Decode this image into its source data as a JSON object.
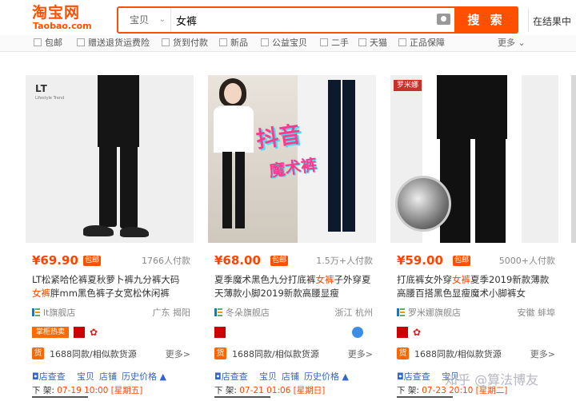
{
  "header": {
    "logo_cn": "淘宝网",
    "logo_en": "Taobao.com",
    "search_scope": "宝贝",
    "search_value": "女裤",
    "search_button": "搜 索",
    "within_results": "在结果中"
  },
  "filters": [
    {
      "label": "包邮"
    },
    {
      "label": "赠送退货运费险"
    },
    {
      "label": "货到付款"
    },
    {
      "label": "新品"
    },
    {
      "label": "公益宝贝"
    },
    {
      "label": "二手"
    },
    {
      "label": "天猫"
    },
    {
      "label": "正品保障"
    }
  ],
  "filters_more": "更多",
  "products": [
    {
      "price": "¥69.90",
      "baoyou": "包邮",
      "deals": "1766人付款",
      "title_pre": "LT松紧哈伦裤夏秋萝卜裤九分裤大码",
      "title_hl": "女裤",
      "title_post": "胖mm黑色裤子女宽松休闲裤",
      "shop": "lt旗舰店",
      "location": "广东 揭阳",
      "badges": [
        "掌柜热卖"
      ],
      "source": "1688同款/相似款货源",
      "more": "更多>",
      "tools": [
        "店查查",
        "宝贝",
        "店铺",
        "历史价格"
      ],
      "sale_prefix": "下 架:",
      "sale_date": "07-19 10:00 [星期五]",
      "image_brand": "LT",
      "image_brand_sub": "Lifestyle Trend"
    },
    {
      "price": "¥68.00",
      "baoyou": "包邮",
      "deals": "1.5万+人付款",
      "title_pre": "夏季魔术黑色九分打底裤",
      "title_hl": "女裤",
      "title_post": "子外穿夏天薄款小脚2019新款高腰显瘦",
      "shop": "冬朵旗舰店",
      "location": "浙江 杭州",
      "badges": [],
      "source": "1688同款/相似款货源",
      "more": "更多>",
      "tools": [
        "店查查",
        "宝贝",
        "店铺",
        "历史价格"
      ],
      "sale_prefix": "下 架:",
      "sale_date": "07-21 01:06 [星期日]",
      "image_text_1": "抖音",
      "image_text_2": "魔术裤"
    },
    {
      "price": "¥59.00",
      "baoyou": "包邮",
      "deals": "5000+人付款",
      "title_pre": "打底裤女外穿",
      "title_hl": "女裤",
      "title_post": "夏季2019新款薄款高腰百搭黑色显瘦魔术小脚裤女",
      "shop": "罗米娜旗舰店",
      "location": "安徽 蚌埠",
      "badges": [],
      "source": "1688同款/相似款货源",
      "more": "更多>",
      "tools": [
        "店查查",
        "宝贝",
        "店铺",
        "历史价格"
      ],
      "sale_prefix": "下 架:",
      "sale_date": "07-23 20:10 [星期二]",
      "image_tag": "罗米娜"
    }
  ],
  "watermark": "知乎 @算法博友",
  "colors": {
    "brand": "#ff5000",
    "price": "#ff4400",
    "link": "#3366cc"
  }
}
